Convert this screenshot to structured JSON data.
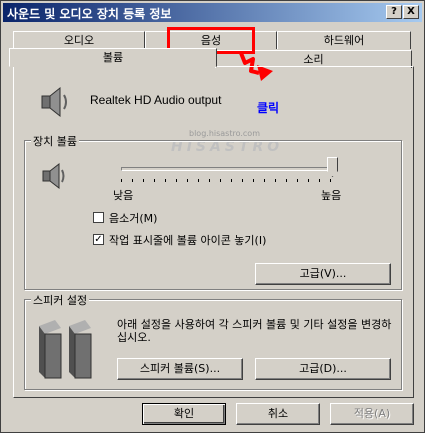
{
  "window": {
    "title": "사운드 및 오디오 장치 등록 정보"
  },
  "titlebar_buttons": {
    "help": "?",
    "close": "X"
  },
  "tabs_row1": [
    "오디오",
    "음성",
    "하드웨어"
  ],
  "tabs_row2": [
    "볼륨",
    "소리"
  ],
  "device": {
    "name": "Realtek HD Audio output"
  },
  "device_volume": {
    "label": "장치 볼륨",
    "low_label": "낮음",
    "high_label": "높음",
    "level_fraction": 1.0,
    "mute_label": "음소거(M)",
    "mute_checked": false,
    "tray_label": "작업 표시줄에 볼륨 아이콘 놓기(I)",
    "tray_checked": true,
    "advanced_label": "고급(V)..."
  },
  "speaker_settings": {
    "label": "스피커 설정",
    "description": "아래 설정을 사용하여 각 스피커 볼륨 및 기타 설정을 변경하십시오.",
    "speaker_volume_label": "스피커 볼륨(S)...",
    "advanced_label": "고급(D)..."
  },
  "footer": {
    "ok": "확인",
    "cancel": "취소",
    "apply": "적용(A)"
  },
  "annotation": {
    "click_text": "클릭",
    "watermark_url": "blog.hisastro.com",
    "watermark_name": "HISASTRO"
  },
  "colors": {
    "highlight_box": "#ff0000",
    "click_text": "#0000ff",
    "arrow": "#ff0000"
  }
}
